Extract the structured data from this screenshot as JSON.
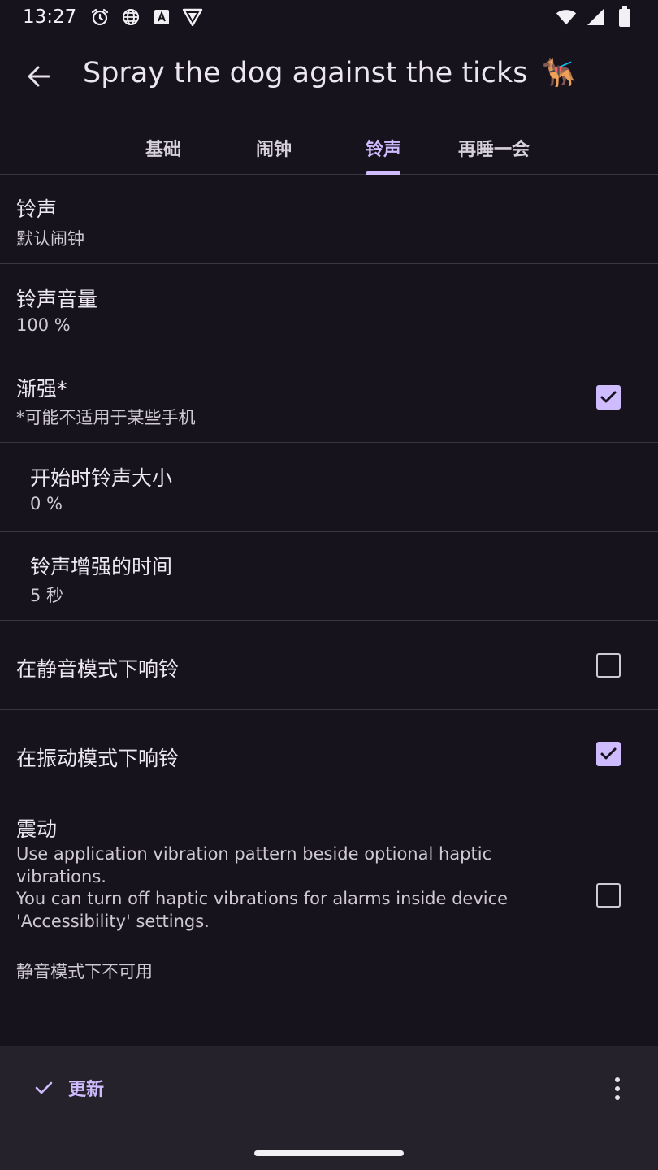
{
  "status_bar": {
    "time": "13:27",
    "icons": [
      "alarm-icon",
      "globe-icon",
      "a-badge-icon",
      "shield-icon",
      "wifi-icon",
      "signal-icon",
      "battery-icon"
    ]
  },
  "app_bar": {
    "title": "Spray the dog against the ticks",
    "title_emoji": "🐕‍🦺",
    "back_icon": "arrow-left-icon"
  },
  "tabs": [
    {
      "label": "基础",
      "active": false
    },
    {
      "label": "闹钟",
      "active": false
    },
    {
      "label": "铃声",
      "active": true
    },
    {
      "label": "再睡一会",
      "active": false
    }
  ],
  "settings": {
    "ringtone": {
      "title": "铃声",
      "summary": "默认闹钟"
    },
    "ringtone_volume": {
      "title": "铃声音量",
      "summary": "100 %"
    },
    "crescendo": {
      "title": "渐强*",
      "summary": "*可能不适用于某些手机",
      "checked": true
    },
    "start_volume": {
      "title": "开始时铃声大小",
      "summary": "0 %"
    },
    "increase_time": {
      "title": "铃声增强的时间",
      "summary": "5 秒"
    },
    "ring_silent": {
      "title": "在静音模式下响铃",
      "checked": false
    },
    "ring_vibrate": {
      "title": "在振动模式下响铃",
      "checked": true
    },
    "vibration": {
      "title": "震动",
      "description_lines": [
        "Use application vibration pattern beside optional haptic",
        "vibrations.",
        "You can turn off haptic vibrations for alarms inside device",
        "'Accessibility' settings."
      ],
      "note": "静音模式下不可用",
      "checked": false
    }
  },
  "bottom_bar": {
    "update_label": "更新",
    "update_icon": "check-icon",
    "overflow_icon": "more-vertical-icon"
  },
  "colors": {
    "background": "#16131c",
    "accent": "#cfbcff",
    "divider": "#3b3742",
    "bottom_bar": "#25222b"
  }
}
